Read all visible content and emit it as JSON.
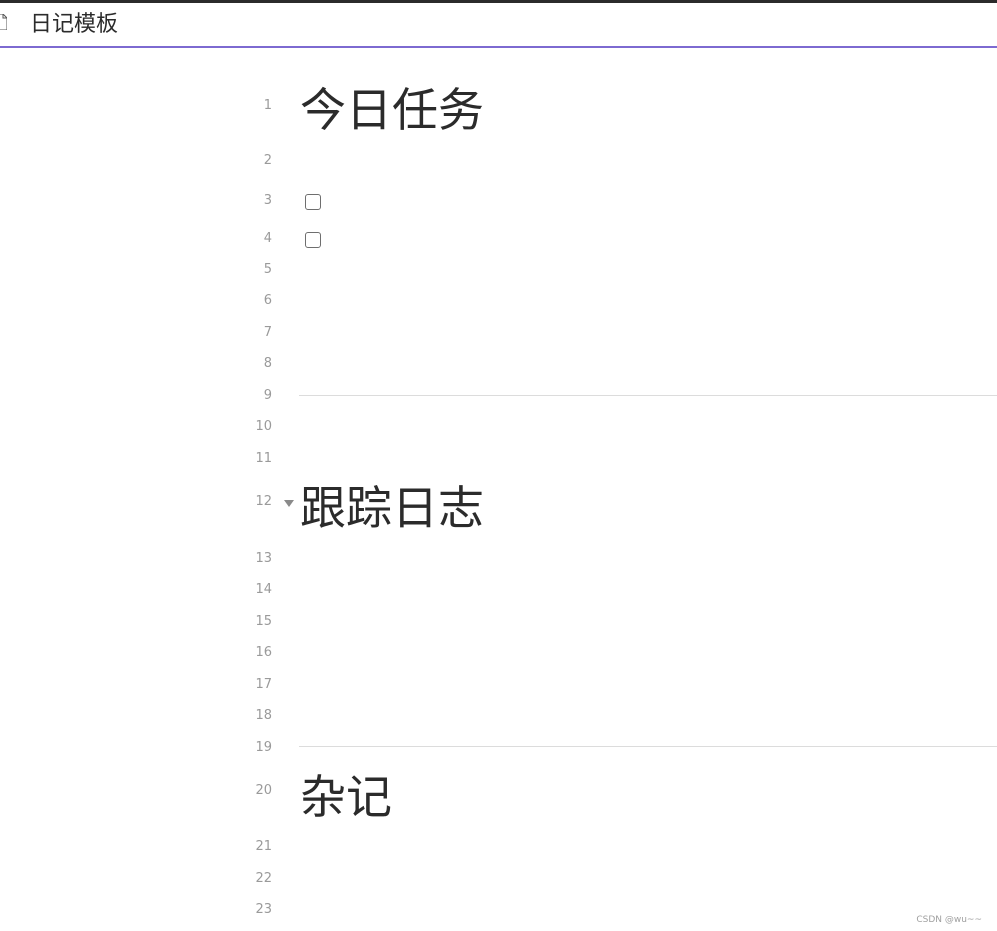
{
  "tab": {
    "title": "日记模板",
    "icon": "file-icon"
  },
  "colors": {
    "accent": "#7d6ad1",
    "text": "#2b2b2b",
    "line_number": "#9a9a9a",
    "rule": "#dcdcdc"
  },
  "editor": {
    "line_numbers": [
      "1",
      "2",
      "3",
      "4",
      "5",
      "6",
      "7",
      "8",
      "9",
      "10",
      "11",
      "12",
      "13",
      "14",
      "15",
      "16",
      "17",
      "18",
      "19",
      "20",
      "21",
      "22",
      "23"
    ],
    "headings": {
      "today_tasks": "今日任务",
      "tracking_log": "跟踪日志",
      "notes": "杂记"
    },
    "tasks": [
      {
        "checked": false
      },
      {
        "checked": false
      }
    ],
    "fold_icon": "chevron-down-icon"
  },
  "watermark": "CSDN @wu~~"
}
